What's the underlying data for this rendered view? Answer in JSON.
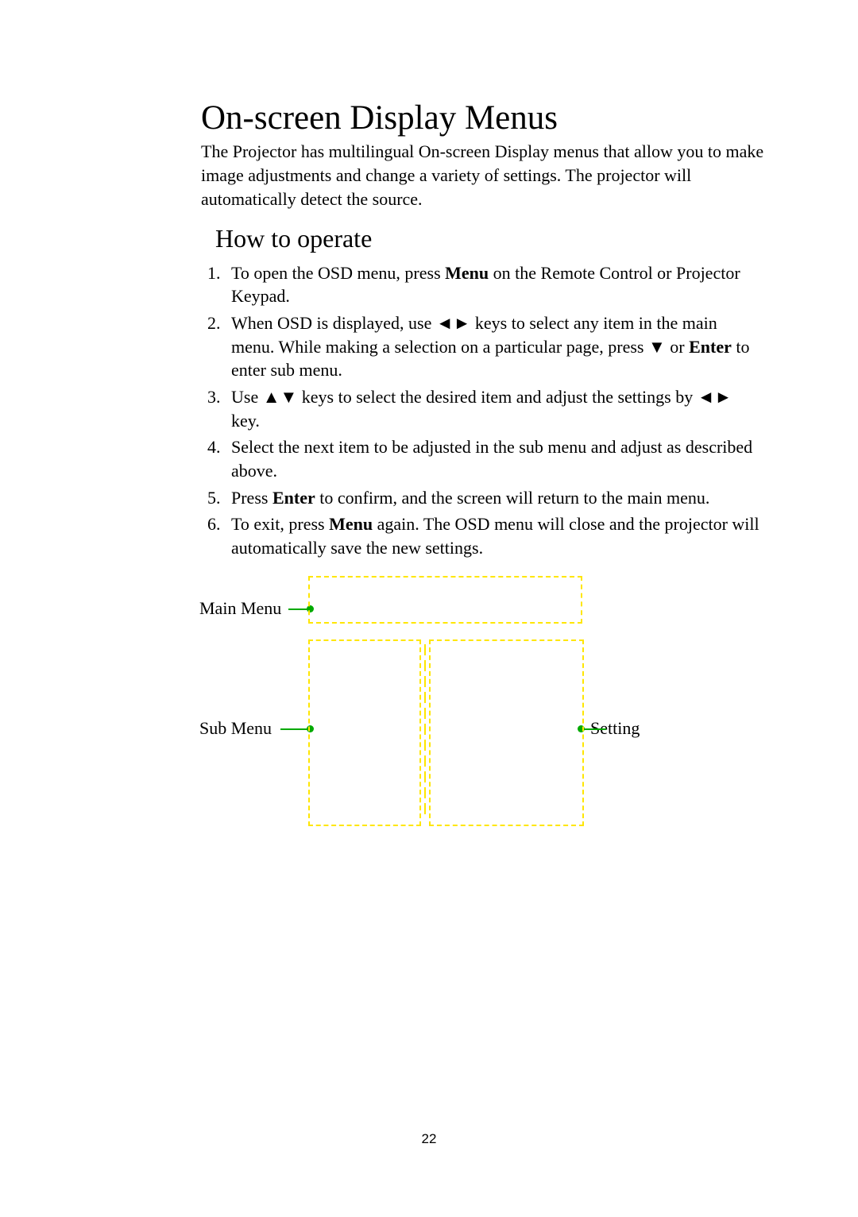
{
  "title": "On-screen Display Menus",
  "intro": "The Projector has multilingual On-screen Display menus that allow you to make image adjustments and change a variety of settings. The projector will automatically detect the source.",
  "subheading": "How to operate",
  "steps": {
    "s1a": "To open the OSD menu, press ",
    "s1b": "Menu",
    "s1c": " on the Remote Control or Projector Keypad.",
    "s2a": "When OSD is displayed, use ◄► keys to select any item in the main menu. While making a selection on a particular page, press ▼ or ",
    "s2b": "Enter",
    "s2c": " to enter sub menu.",
    "s3": "Use ▲▼ keys to select the desired item and adjust the settings by ◄► key.",
    "s4": "Select the next item to be adjusted in the sub menu and adjust as described above.",
    "s5a": "Press ",
    "s5b": "Enter",
    "s5c": " to confirm, and the screen will return to the main menu.",
    "s6a": "To exit, press ",
    "s6b": "Menu",
    "s6c": " again. The OSD menu will close and the projector will automatically save the new settings."
  },
  "labels": {
    "mainMenu": "Main Menu",
    "subMenu": "Sub Menu",
    "setting": "Setting"
  },
  "pageNumber": "22"
}
